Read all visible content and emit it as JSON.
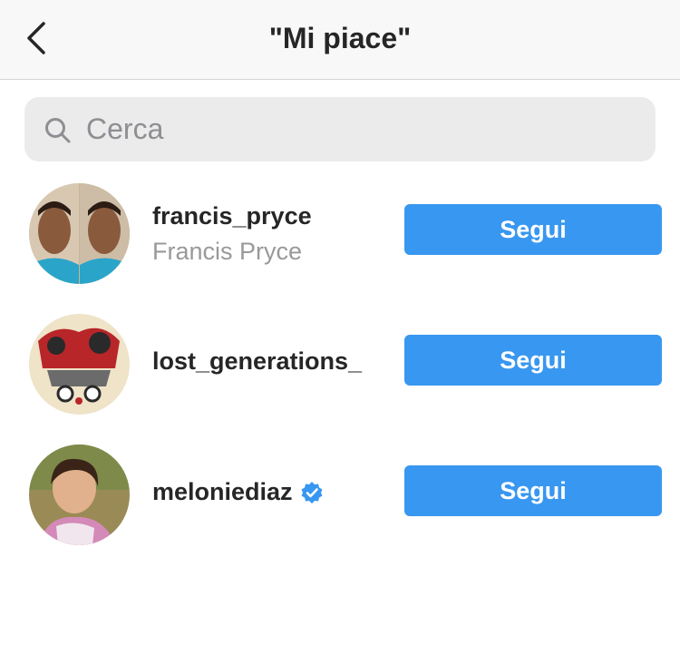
{
  "header": {
    "title": "\"Mi piace\"",
    "back_icon": "chevron-left-icon"
  },
  "search": {
    "placeholder": "Cerca",
    "value": "",
    "icon": "search-icon"
  },
  "users": [
    {
      "username": "francis_pryce",
      "full_name": "Francis Pryce",
      "verified": false,
      "button_label": "Segui"
    },
    {
      "username": "lost_generations_",
      "full_name": "",
      "verified": false,
      "button_label": "Segui"
    },
    {
      "username": "meloniediaz",
      "full_name": "",
      "verified": true,
      "button_label": "Segui"
    }
  ],
  "colors": {
    "accent": "#3897f0",
    "verified_badge": "#3897f0",
    "header_bg": "#f8f8f8",
    "search_bg": "#ebebec"
  }
}
